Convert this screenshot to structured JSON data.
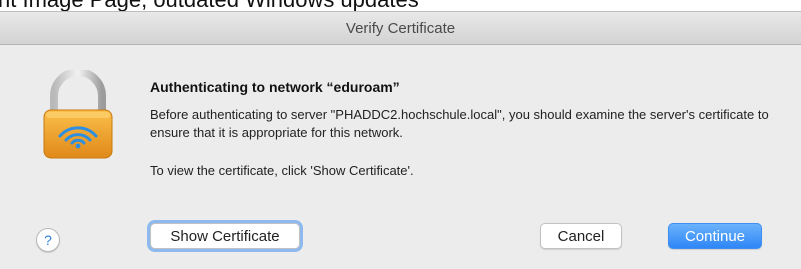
{
  "background": {
    "partial_text": "nt Image Page, outdated Windows updates"
  },
  "dialog": {
    "title": "Verify Certificate",
    "icon": "lock-wifi-icon",
    "heading": "Authenticating to network “eduroam”",
    "message": "Before authenticating to server \"PHADDC2.hochschule.local\", you should examine the server's certificate to ensure that it is appropriate for this network.",
    "instruction": "To view the certificate, click 'Show Certificate'.",
    "help_label": "?",
    "buttons": {
      "show_certificate": "Show Certificate",
      "cancel": "Cancel",
      "continue": "Continue"
    },
    "colors": {
      "accent": "#2f86f6",
      "lock_body": "#f0a52e",
      "lock_shackle": "#c8c8c8"
    }
  }
}
